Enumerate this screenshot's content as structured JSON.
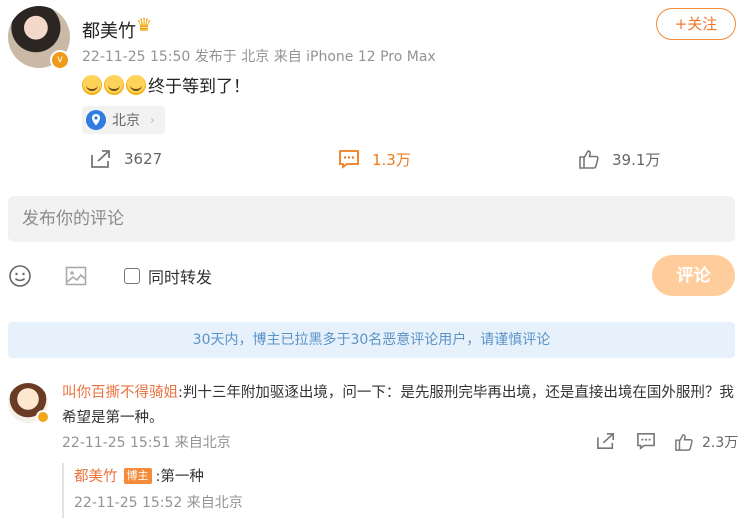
{
  "post": {
    "username": "都美竹",
    "meta": "22-11-25 15:50  发布于 北京  来自 iPhone 12 Pro Max",
    "follow_label": "+关注",
    "text": "终于等到了！",
    "emoji_count": 3,
    "location": "北京",
    "stats": {
      "shares": "3627",
      "comments": "1.3万",
      "likes": "39.1万"
    }
  },
  "composer": {
    "placeholder": "发布你的评论",
    "repost_label": "同时转发",
    "submit_label": "评论"
  },
  "notice": "30天内，博主已拉黑多于30名恶意评论用户，请谨慎评论",
  "comment": {
    "username": "叫你百撕不得骑姐",
    "text": ":判十三年附加驱逐出境，问一下：是先服刑完毕再出境，还是直接出境在国外服刑？我希望是第一种。",
    "time": "22-11-25 15:51 来自北京",
    "likes": "2.3万",
    "reply": {
      "username": "都美竹",
      "badge": "博主",
      "text": ":第一种",
      "time": "22-11-25 15:52 来自北京"
    }
  },
  "colors": {
    "accent": "#f0762a",
    "notice_bg": "#e6f1fb",
    "notice_text": "#5a93c8",
    "submit_bg": "#ffcd9c"
  }
}
